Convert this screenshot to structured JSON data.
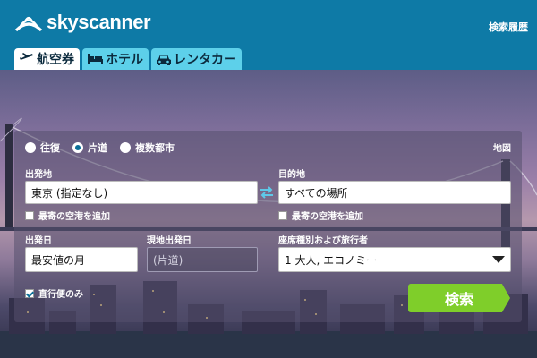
{
  "brand": {
    "name": "skyscanner"
  },
  "header": {
    "history_link": "検索履歴"
  },
  "tabs": [
    {
      "label": "航空券",
      "icon": "airplane-icon",
      "active": true
    },
    {
      "label": "ホテル",
      "icon": "bed-icon",
      "active": false
    },
    {
      "label": "レンタカー",
      "icon": "car-icon",
      "active": false
    }
  ],
  "search": {
    "trip_types": [
      {
        "label": "往復",
        "selected": false
      },
      {
        "label": "片道",
        "selected": true
      },
      {
        "label": "複数都市",
        "selected": false
      }
    ],
    "map_link": "地図",
    "origin_label": "出発地",
    "origin_value": "東京 (指定なし)",
    "origin_nearby": "最寄の空港を追加",
    "destination_label": "目的地",
    "destination_value": "すべての場所",
    "destination_nearby": "最寄の空港を追加",
    "depart_label": "出発日",
    "depart_value": "最安値の月",
    "local_depart_label": "現地出発日",
    "local_depart_value": "(片道)",
    "cabin_label": "座席種別および旅行者",
    "cabin_value": "1 大人, エコノミー",
    "direct_only": "直行便のみ",
    "direct_only_checked": true,
    "search_button": "検索"
  },
  "colors": {
    "header": "#0e7aa6",
    "tab": "#5dd0ea",
    "search_button": "#7fce2a"
  }
}
